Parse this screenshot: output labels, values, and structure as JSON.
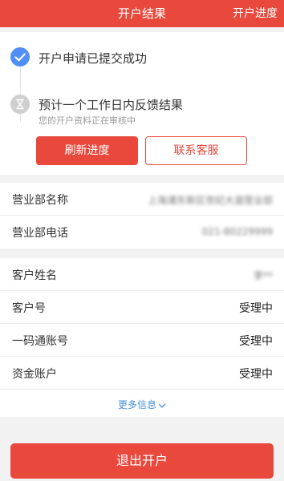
{
  "header": {
    "title": "开户结果",
    "progress_link": "开户进度",
    "color": "#e8493c"
  },
  "status": {
    "steps": [
      {
        "label": "开户申请已提交成功",
        "state": "done",
        "icon": "check-circle-icon"
      },
      {
        "label": "预计一个工作日内反馈结果",
        "sublabel": "您的开户资料正在审核中",
        "state": "pending",
        "icon": "hourglass-icon"
      }
    ],
    "refresh_button": "刷新进度",
    "contact_button": "联系客服"
  },
  "branch": {
    "name_label": "营业部名称",
    "name_value": "上海浦东新区世纪大道营业部",
    "phone_label": "营业部电话",
    "phone_value": "021-80229999"
  },
  "client": {
    "rows": [
      {
        "label": "客户姓名",
        "value": "李**"
      },
      {
        "label": "客户号",
        "value": "受理中"
      },
      {
        "label": "一码通账号",
        "value": "受理中"
      },
      {
        "label": "资金账户",
        "value": "受理中"
      }
    ],
    "more_link": "更多信息"
  },
  "footer": {
    "exit_button": "退出开户"
  }
}
